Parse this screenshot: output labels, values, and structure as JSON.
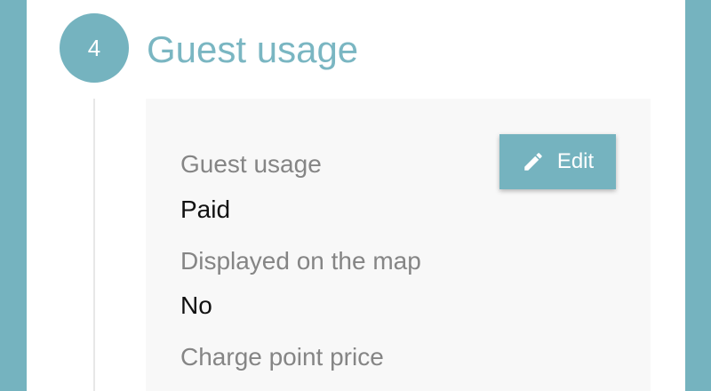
{
  "step": {
    "number": "4",
    "title": "Guest usage"
  },
  "actions": {
    "edit_label": "Edit",
    "edit_icon": "pencil-icon"
  },
  "fields": [
    {
      "label": "Guest usage",
      "value": "Paid"
    },
    {
      "label": "Displayed on the map",
      "value": "No"
    },
    {
      "label": "Charge point price"
    }
  ],
  "colors": {
    "accent": "#75b3bf",
    "title": "#7ab6c2",
    "card_background": "#f8f8f8",
    "label": "#858585",
    "value": "#111111"
  }
}
